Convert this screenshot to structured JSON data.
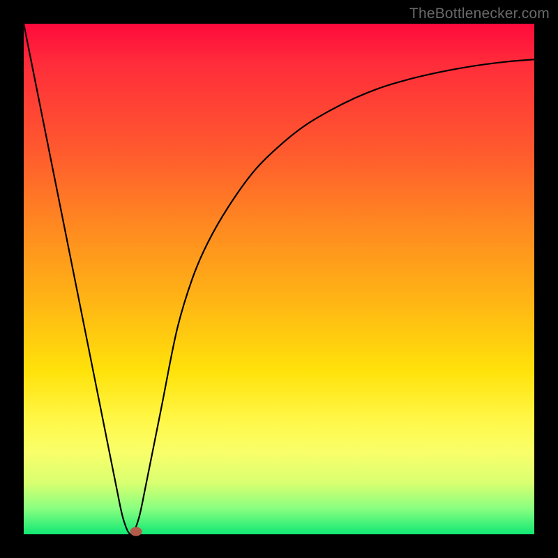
{
  "watermark": {
    "text": "TheBottlenecker.com"
  },
  "chart_data": {
    "type": "line",
    "title": "",
    "xlabel": "",
    "ylabel": "",
    "xlim": [
      0,
      100
    ],
    "ylim": [
      0,
      100
    ],
    "gradient_meaning": "red high → green low (bottleneck badness scale)",
    "x": [
      0,
      3,
      6,
      9,
      12,
      15,
      18,
      19.5,
      21,
      22.5,
      24,
      27,
      30,
      33,
      36,
      40,
      45,
      50,
      55,
      60,
      65,
      70,
      75,
      80,
      85,
      90,
      95,
      100
    ],
    "series": [
      {
        "name": "bottleneck-curve",
        "values": [
          100,
          85,
          70,
          55,
          40,
          25,
          10,
          3,
          0,
          3,
          10,
          25,
          40,
          50,
          57,
          64,
          71,
          76,
          80,
          83,
          85.5,
          87.5,
          89,
          90.2,
          91.2,
          92,
          92.6,
          93
        ]
      }
    ],
    "marker": {
      "x": 22,
      "y": 0.5,
      "color": "#b45a4a"
    }
  }
}
